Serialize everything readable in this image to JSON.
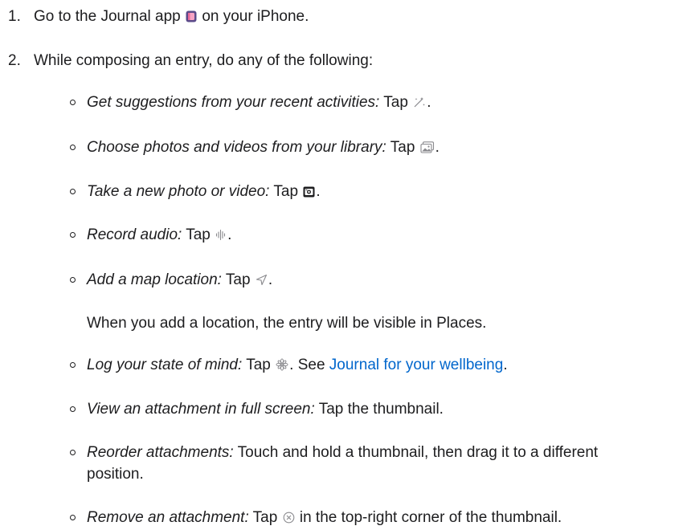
{
  "steps": [
    {
      "num": "1.",
      "text_before": "Go to the Journal app",
      "icon": "journal-app-icon",
      "text_after": "on your iPhone."
    },
    {
      "num": "2.",
      "text": "While composing an entry, do any of the following:"
    }
  ],
  "bullets": [
    {
      "term": "Get suggestions from your recent activities:",
      "tap": "Tap",
      "icon": "magic-wand-icon",
      "end": "."
    },
    {
      "term": "Choose photos and videos from your library:",
      "tap": "Tap",
      "icon": "photo-library-icon",
      "end": "."
    },
    {
      "term": "Take a new photo or video:",
      "tap": "Tap",
      "icon": "camera-icon",
      "end": "."
    },
    {
      "term": "Record audio:",
      "tap": "Tap",
      "icon": "waveform-icon",
      "end": "."
    },
    {
      "term": "Add a map location:",
      "tap": "Tap",
      "icon": "location-arrow-icon",
      "end": "."
    },
    {
      "term": "Log your state of mind:",
      "tap": "Tap",
      "icon": "state-of-mind-icon",
      "mid": ". See",
      "link": "Journal for your wellbeing",
      "end": "."
    },
    {
      "term": "View an attachment in full screen:",
      "text": "Tap the thumbnail."
    },
    {
      "term": "Reorder attachments:",
      "text": "Touch and hold a thumbnail, then drag it to a different position."
    },
    {
      "term": "Remove an attachment:",
      "tap": "Tap",
      "icon": "remove-circle-icon",
      "end": "in the top-right corner of the thumbnail."
    }
  ],
  "location_note": "When you add a location, the entry will be visible in Places.",
  "colors": {
    "text": "#1d1d1f",
    "link": "#0066cc"
  }
}
